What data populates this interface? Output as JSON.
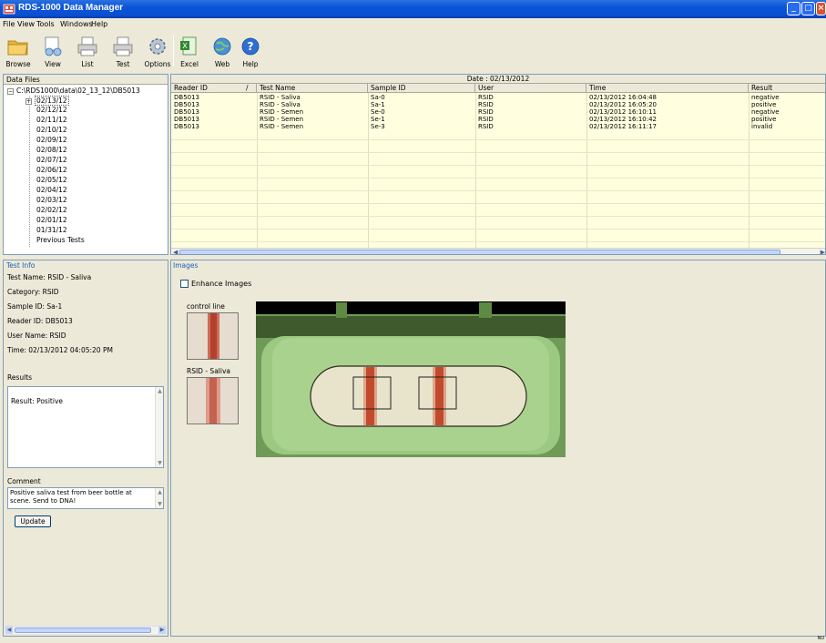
{
  "window": {
    "title": "RDS-1000 Data Manager"
  },
  "menu": [
    "File",
    "View",
    "Tools",
    "Windows",
    "Help"
  ],
  "toolbar": [
    {
      "label": "Browse",
      "icon": "folder-icon"
    },
    {
      "label": "View",
      "icon": "view-icon"
    },
    {
      "label": "List",
      "icon": "printer-icon"
    },
    {
      "label": "Test",
      "icon": "printer-icon"
    },
    {
      "label": "Options",
      "icon": "gear-icon"
    },
    {
      "label": "Excel",
      "icon": "excel-icon"
    },
    {
      "label": "Web",
      "icon": "globe-icon"
    },
    {
      "label": "Help",
      "icon": "help-icon"
    }
  ],
  "data_files": {
    "header": "Data Files",
    "root": "C:\\RDS1000\\data\\02_13_12\\DB5013",
    "items": [
      "02/13/12",
      "02/12/12",
      "02/11/12",
      "02/10/12",
      "02/09/12",
      "02/08/12",
      "02/07/12",
      "02/06/12",
      "02/05/12",
      "02/04/12",
      "02/03/12",
      "02/02/12",
      "02/01/12",
      "01/31/12",
      "Previous Tests"
    ]
  },
  "grid": {
    "date_label": "Date : 02/13/2012",
    "sort_indicator": "/",
    "columns": [
      "Reader ID",
      "Test Name",
      "Sample ID",
      "User",
      "Time",
      "Result"
    ],
    "rows": [
      [
        "DB5013",
        "RSID - Saliva",
        "Sa-0",
        "RSID",
        "02/13/2012 16:04:48",
        "negative"
      ],
      [
        "DB5013",
        "RSID - Saliva",
        "Sa-1",
        "RSID",
        "02/13/2012 16:05:20",
        "positive"
      ],
      [
        "DB5013",
        "RSID - Semen",
        "Se-0",
        "RSID",
        "02/13/2012 16:10:11",
        "negative"
      ],
      [
        "DB5013",
        "RSID - Semen",
        "Se-1",
        "RSID",
        "02/13/2012 16:10:42",
        "positive"
      ],
      [
        "DB5013",
        "RSID - Semen",
        "Se-3",
        "RSID",
        "02/13/2012 16:11:17",
        "invalid"
      ]
    ]
  },
  "test_info": {
    "header": "Test Info",
    "test_name": "Test Name: RSID - Saliva",
    "category": "Category: RSID",
    "sample_id": "Sample ID: Sa-1",
    "reader_id": "Reader ID: DB5013",
    "user_name": "User Name: RSID",
    "time": "Time: 02/13/2012  04:05:20 PM",
    "results_label": "Results",
    "result_text": "Result: Positive",
    "comment_label": "Comment",
    "comment_text": "Positive saliva test from beer bottle at scene. Send to DNA!",
    "update_label": "Update"
  },
  "images": {
    "header": "Images",
    "enhance_label": "Enhance Images",
    "thumb1_label": "control line",
    "thumb2_label": "RSID - Saliva"
  },
  "status": {
    "text": "NU"
  },
  "colors": {
    "titlebar": "#0a54d8",
    "grid_bg": "#ffffe0",
    "strip_green": "#8bc06a",
    "band_red": "#c0341c"
  }
}
